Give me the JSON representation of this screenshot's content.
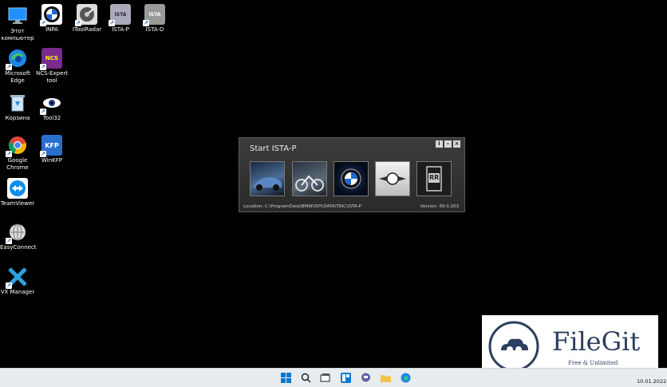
{
  "desktop": {
    "icons": [
      {
        "label": "Этот компьютер"
      },
      {
        "label": "INPA"
      },
      {
        "label": "IToolRadar"
      },
      {
        "label": "ISTA-P"
      },
      {
        "label": "ISTA-D"
      },
      {
        "label": "Microsoft Edge"
      },
      {
        "label": "NCS-Expert tool"
      },
      {
        "label": "Корзина"
      },
      {
        "label": "Tool32"
      },
      {
        "label": "Google Chrome"
      },
      {
        "label": "WinKFP"
      },
      {
        "label": "TeamViewer"
      },
      {
        "label": "EasyConnect"
      },
      {
        "label": "VX Manager"
      }
    ]
  },
  "dialog": {
    "title": "Start ISTA-P",
    "location": "Location: C:\\ProgramData\\BMW\\ISPI\\DATA\\TRIC\\ISTA-P",
    "version": "Version: 69.0.203",
    "brands": [
      "BMW cars",
      "BMW Motorrad",
      "BMW",
      "MINI",
      "Rolls-Royce"
    ],
    "brand_rr_text": "RR"
  },
  "watermark": {
    "name": "FileGit",
    "tagline": "Free & Unlimited"
  },
  "taskbar": {
    "date": "10.01.2022"
  },
  "colors": {
    "desktop": "#000000",
    "watermark_text": "#2b3f5e",
    "taskbar": "#e9ecef"
  }
}
